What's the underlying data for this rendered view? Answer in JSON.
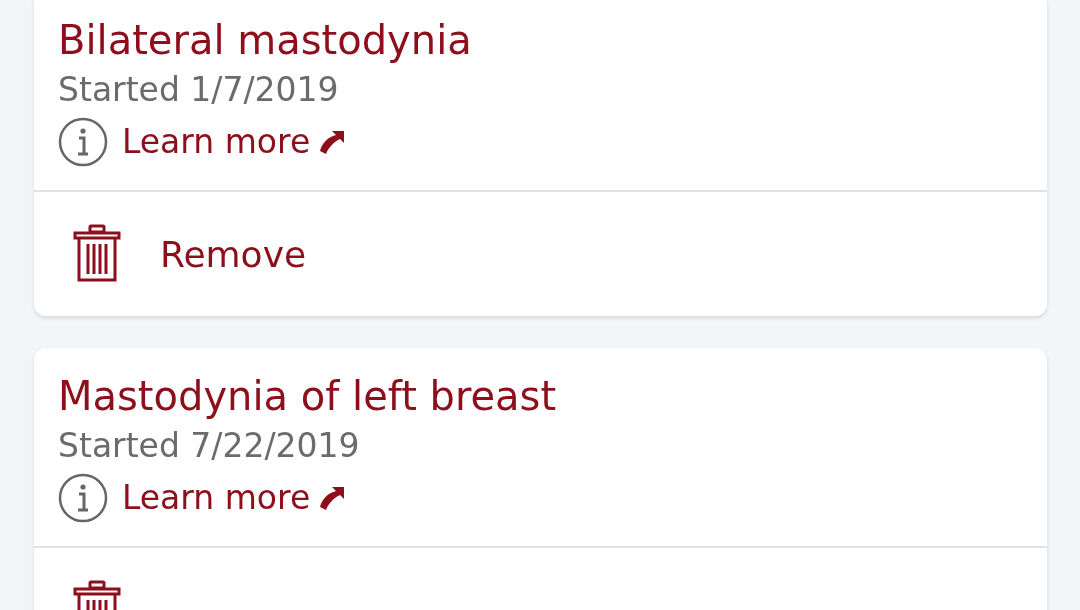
{
  "conditions": [
    {
      "title": "Bilateral mastodynia",
      "started": "Started 1/7/2019",
      "link": "Learn more",
      "remove_label": "Remove"
    },
    {
      "title": "Mastodynia of left breast",
      "started": "Started 7/22/2019",
      "link": "Learn more"
    }
  ]
}
